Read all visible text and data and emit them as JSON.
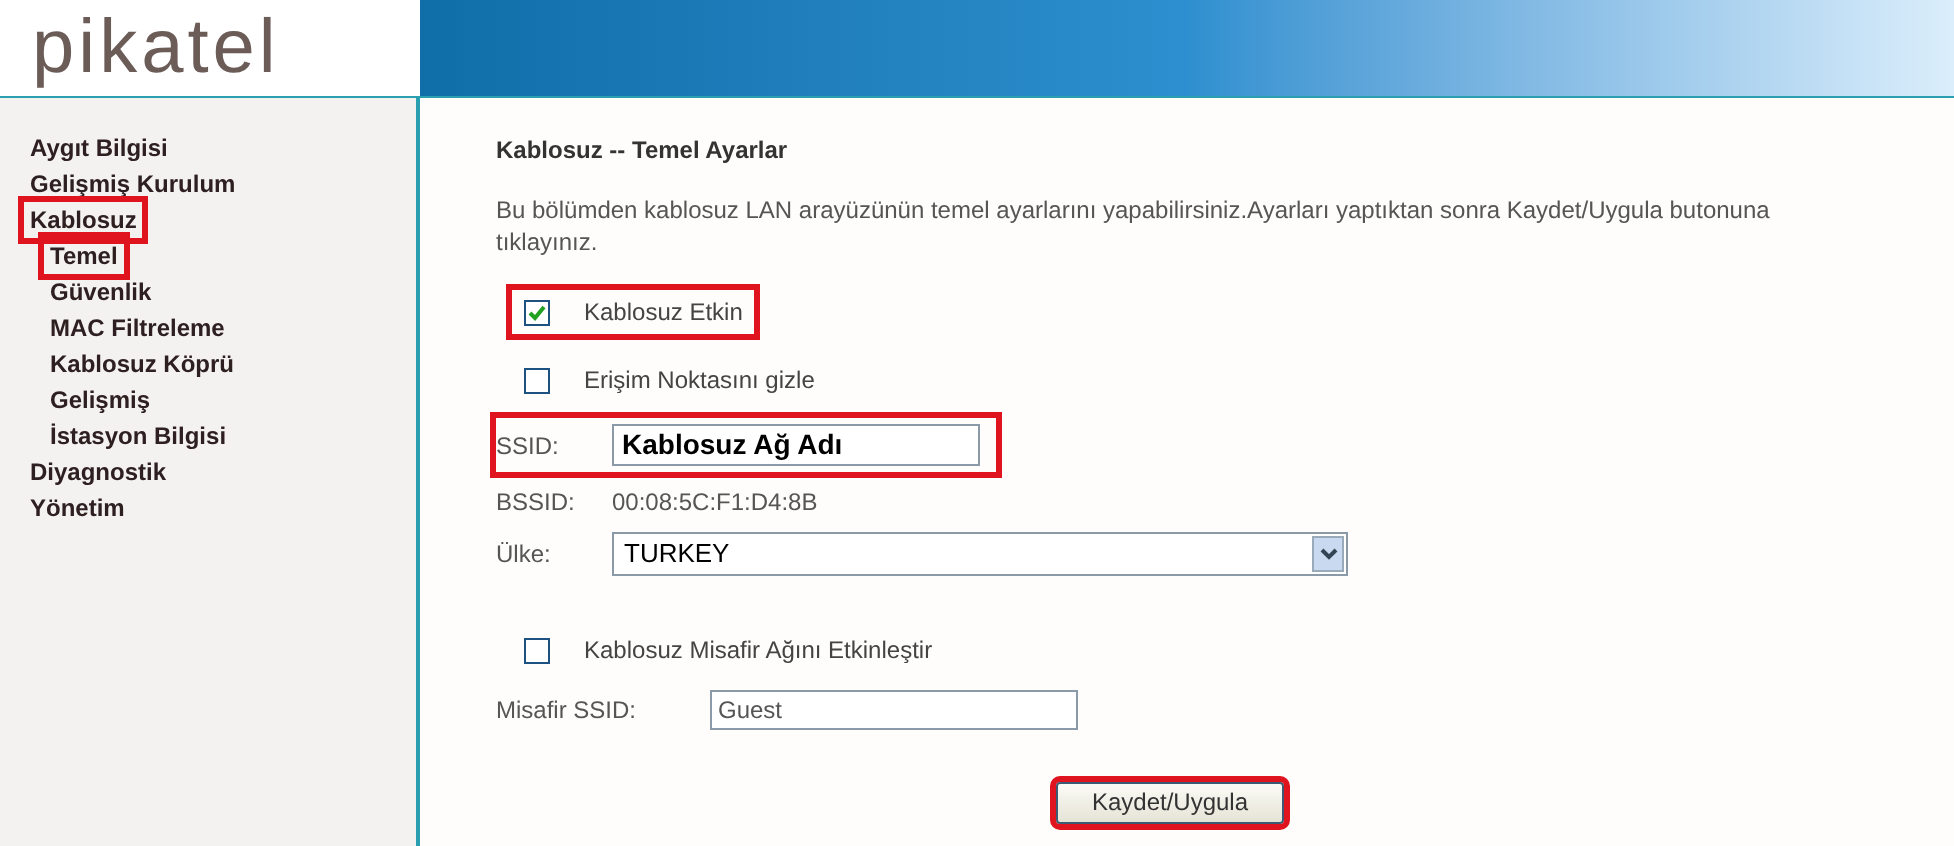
{
  "logo": {
    "text": "pikatel"
  },
  "sidebar": {
    "items": [
      {
        "label": "Aygıt Bilgisi",
        "highlighted": false
      },
      {
        "label": "Gelişmiş Kurulum",
        "highlighted": false
      },
      {
        "label": "Kablosuz",
        "highlighted": true,
        "children": [
          {
            "label": "Temel",
            "highlighted": true
          },
          {
            "label": "Güvenlik",
            "highlighted": false
          },
          {
            "label": "MAC Filtreleme",
            "highlighted": false
          },
          {
            "label": "Kablosuz Köprü",
            "highlighted": false
          },
          {
            "label": "Gelişmiş",
            "highlighted": false
          },
          {
            "label": "İstasyon Bilgisi",
            "highlighted": false
          }
        ]
      },
      {
        "label": "Diyagnostik",
        "highlighted": false
      },
      {
        "label": "Yönetim",
        "highlighted": false
      }
    ]
  },
  "content": {
    "title": "Kablosuz -- Temel Ayarlar",
    "description": "Bu bölümden kablosuz LAN arayüzünün temel ayarlarını yapabilirsiniz.Ayarları yaptıktan sonra Kaydet/Uygula butonuna tıklayınız.",
    "enable": {
      "label": "Kablosuz Etkin",
      "checked": true,
      "highlighted": true
    },
    "hide_ap": {
      "label": "Erişim Noktasını gizle",
      "checked": false,
      "highlighted": false
    },
    "ssid": {
      "label": "SSID:",
      "value": "Kablosuz Ağ Adı",
      "highlighted": true
    },
    "bssid": {
      "label": "BSSID:",
      "value": "00:08:5C:F1:D4:8B"
    },
    "country": {
      "label": "Ülke:",
      "value": "TURKEY"
    },
    "guest_enable": {
      "label": "Kablosuz Misafir Ağını Etkinleştir",
      "checked": false,
      "highlighted": false
    },
    "guest_ssid": {
      "label": "Misafir SSID:",
      "value": "Guest"
    },
    "save_button": {
      "label": "Kaydet/Uygula",
      "highlighted": true
    }
  }
}
